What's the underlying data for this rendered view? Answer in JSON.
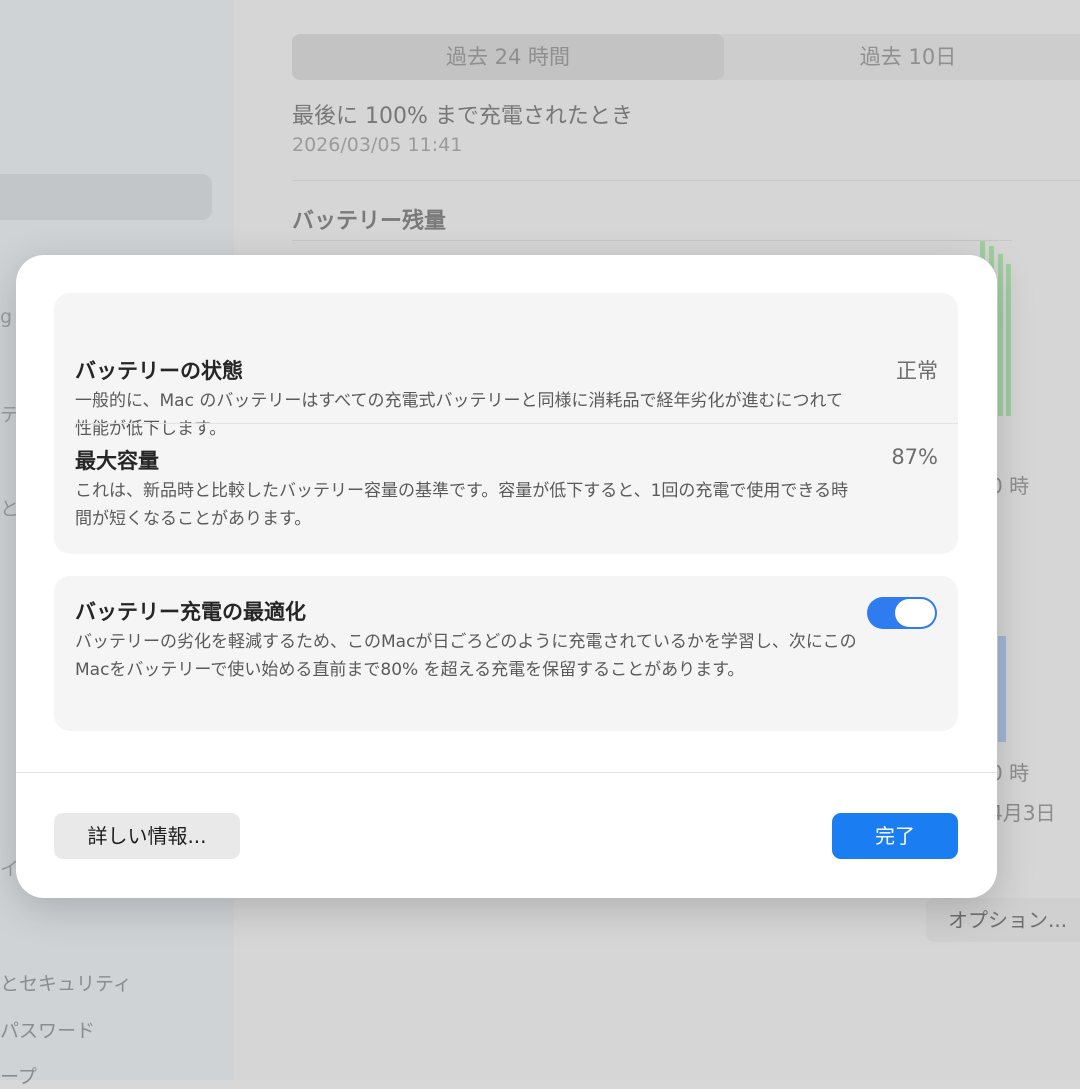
{
  "background": {
    "sidebar_items": [
      "とセキュリティ",
      "パスワード",
      "ープ"
    ],
    "sidebar_fragments": [
      "g",
      "テ",
      "と",
      "イ"
    ],
    "tabs": [
      "過去 24 時間",
      "過去 10日"
    ],
    "last_charge_title": "最後に 100% まで充電されたとき",
    "last_charge_date": "2026/03/05 11:41",
    "battery_level_title": "バッテリー残量",
    "axis_label_1": "0 時",
    "axis_label_2": "0 時",
    "date_label": "4月3日",
    "options_button": "オプション..."
  },
  "modal": {
    "battery_health": {
      "title": "バッテリーの状態",
      "description": "一般的に、Mac のバッテリーはすべての充電式バッテリーと同様に消耗品で経年劣化が進むにつれて性能が低下します。",
      "value": "正常"
    },
    "max_capacity": {
      "title": "最大容量",
      "description": "これは、新品時と比較したバッテリー容量の基準です。容量が低下すると、1回の充電で使用できる時間が短くなることがあります。",
      "value": "87%"
    },
    "optimized_charging": {
      "title": "バッテリー充電の最適化",
      "description": "バッテリーの劣化を軽減するため、このMacが日ごろどのように充電されているかを学習し、次にこのMacをバッテリーで使い始める直前まで80% を超える充電を保留することがあります。",
      "enabled": true
    },
    "more_info_button": "詳しい情報...",
    "done_button": "完了"
  },
  "colors": {
    "accent": "#1a7ef2",
    "toggle_on": "#2f7cf0"
  }
}
